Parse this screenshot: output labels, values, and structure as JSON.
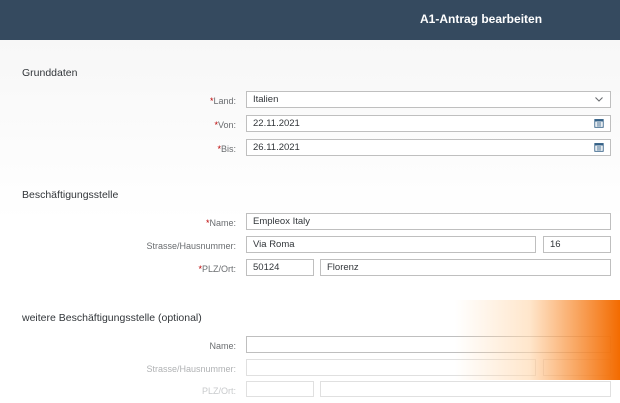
{
  "header": {
    "title": "A1-Antrag bearbeiten"
  },
  "sections": {
    "grunddaten": {
      "title": "Grunddaten",
      "land": {
        "required": "*",
        "label": "Land:",
        "value": "Italien"
      },
      "von": {
        "required": "*",
        "label": "Von:",
        "value": "22.11.2021"
      },
      "bis": {
        "required": "*",
        "label": "Bis:",
        "value": "26.11.2021"
      }
    },
    "beschaeftigungsstelle": {
      "title": "Beschäftigungsstelle",
      "name": {
        "required": "*",
        "label": "Name:",
        "value": "Empleox Italy"
      },
      "strasse": {
        "label": "Strasse/Hausnummer:",
        "street": "Via Roma",
        "number": "16"
      },
      "plzort": {
        "required": "*",
        "label": "PLZ/Ort:",
        "plz": "50124",
        "ort": "Florenz"
      }
    },
    "weitere": {
      "title": "weitere Beschäftigungsstelle (optional)",
      "name": {
        "label": "Name:",
        "value": ""
      },
      "strasse": {
        "label": "Strasse/Hausnummer:",
        "street": "",
        "number": ""
      },
      "plzort": {
        "label": "PLZ/Ort:",
        "plz": "",
        "ort": ""
      }
    }
  },
  "icons": {
    "dropdown": "chevron-down-icon",
    "calendar": "calendar-icon"
  },
  "colors": {
    "header_bg": "#354a5f",
    "required": "#bb0000",
    "accent_orange": "#f36b00"
  }
}
